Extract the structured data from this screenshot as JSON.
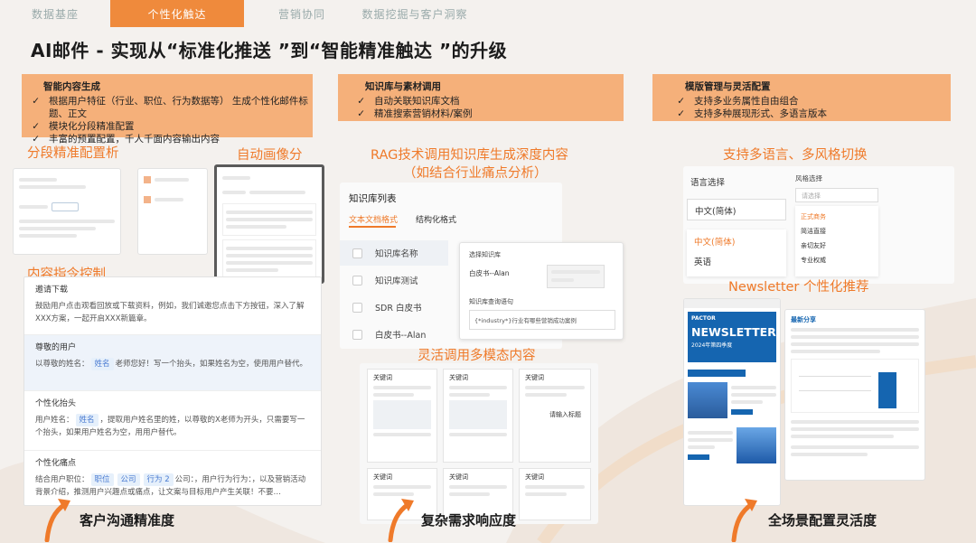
{
  "tabs": [
    {
      "label": "数据基座",
      "active": false
    },
    {
      "label": "个性化触达",
      "active": true
    },
    {
      "label": "营销协同",
      "active": false
    },
    {
      "label": "数据挖掘与客户洞察",
      "active": false
    }
  ],
  "headline": "AI邮件 - 实现从“标准化推送 ”到“智能精准触达 ”的升级",
  "bands": [
    {
      "title": "智能内容生成",
      "items": [
        "根据用户特征（行业、职位、行为数据等） 生成个性化邮件标题、正文",
        "模块化分段精准配置",
        "丰富的预置配置，千人千面内容输出内容"
      ]
    },
    {
      "title": "知识库与素材调用",
      "items": [
        "自动关联知识库文档",
        "精准搜索营销材料/案例"
      ]
    },
    {
      "title": "模版管理与灵活配置",
      "items": [
        "支持多业务属性自由组合",
        "支持多种展现形式、多语言版本"
      ]
    }
  ],
  "check_mark": "✓",
  "labels": {
    "segment_config": "分段精准配置析",
    "auto_persona": "自动画像分",
    "instruction_control": "内容指令控制",
    "rag_line1": "RAG技术调用知识库生成深度内容",
    "rag_line2": "（如结合行业痛点分析）",
    "multimodal": "灵活调用多模态内容",
    "multilang": "支持多语言、多风格切换",
    "newsletter_rec": "Newsletter 个性化推荐"
  },
  "instruction_card": {
    "sections": [
      {
        "title": "邀请下载",
        "desc": "鼓励用户点击观看回放或下载资料，例如，我们诚邀您点击下方按钮，深入了解XXX方案，一起开启XXX新篇章。",
        "highlight": false
      },
      {
        "title": "尊敬的用户",
        "desc_before": "以尊敬的姓名：",
        "chip": "姓名",
        "desc_after": "老师您好！写一个抬头，如果姓名为空，使用用户替代。",
        "highlight": true
      },
      {
        "title": "个性化抬头",
        "desc_before": "用户姓名：",
        "chip": "姓名",
        "desc_after": "，提取用户姓名里的姓，以尊敬的X老师为开头，只需要写一个抬头，如果用户姓名为空，用用户替代。",
        "highlight": false
      },
      {
        "title": "个性化痛点",
        "desc_before": "结合用户职位：",
        "chip": "职位",
        "chip2": "公司",
        "chip3": "行为 2",
        "desc_after": "公司：，用户行为行为：，以及营销活动背景介绍，推测用户兴趣点或痛点，让文案与目标用户产生关联！不要…",
        "highlight": false
      }
    ]
  },
  "kb_card": {
    "title": "知识库列表",
    "tab_active": "文本文档格式",
    "tab_other": "结构化格式",
    "rows": [
      "知识库名称",
      "知识库测试",
      "SDR 白皮书",
      "白皮书--Alan"
    ],
    "select_label": "选择知识库",
    "select_value": "白皮书--Alan",
    "query_label": "知识库查询语句",
    "query_value": "{*industry*}行业有哪些营销成功案例"
  },
  "lang_card": {
    "lang_label": "语言选择",
    "lang_value": "中文(简体)",
    "lang_options": [
      "中文(简体)",
      "英语"
    ],
    "style_label": "风格选择",
    "style_placeholder": "请选择",
    "style_options": [
      "正式商务",
      "简洁直接",
      "亲切友好",
      "专业权威"
    ]
  },
  "newsletter": {
    "brand": "PACTOR",
    "title": "NEWSLETTER",
    "subtitle": "2024年第四季度",
    "sec_title": "最新分享"
  },
  "tiles": [
    {
      "t": "关键词"
    },
    {
      "t": "关键词"
    },
    {
      "t": "关键词"
    },
    {
      "t": "关键词"
    },
    {
      "t": "关键词"
    },
    {
      "t": "关键词"
    }
  ],
  "tile_button": "请输入标题",
  "bottom": {
    "left": "客户沟通精准度",
    "middle": "复杂需求响应度",
    "right": "全场景配置灵活度"
  },
  "colors": {
    "accent": "#ef7a2a",
    "band": "#f5b07a",
    "tab_active": "#ef8a3c",
    "link_blue": "#4a7bd2"
  }
}
